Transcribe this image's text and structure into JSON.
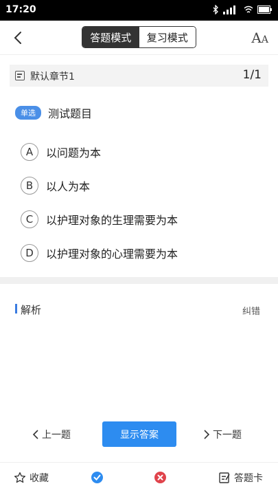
{
  "status": {
    "time": "17:20",
    "network": "4G"
  },
  "header": {
    "modes": [
      {
        "label": "答题模式",
        "active": true
      },
      {
        "label": "复习模式",
        "active": false
      }
    ],
    "font_icon_large": "A",
    "font_icon_small": "A"
  },
  "chapter": {
    "title": "默认章节1",
    "progress": "1/1"
  },
  "question": {
    "type": "单选",
    "text": "测试题目",
    "options": [
      {
        "letter": "A",
        "text": "以问题为本"
      },
      {
        "letter": "B",
        "text": "以人为本"
      },
      {
        "letter": "C",
        "text": "以护理对象的生理需要为本"
      },
      {
        "letter": "D",
        "text": "以护理对象的心理需要为本"
      }
    ]
  },
  "analysis": {
    "title": "解析",
    "report_error": "纠错"
  },
  "nav": {
    "prev": "上一题",
    "show_answer": "显示答案",
    "next": "下一题"
  },
  "bottom": {
    "favorite": "收藏",
    "answer_card": "答题卡"
  },
  "colors": {
    "accent": "#2d8cf0",
    "wrong": "#e0434b",
    "dark": "#333333"
  }
}
